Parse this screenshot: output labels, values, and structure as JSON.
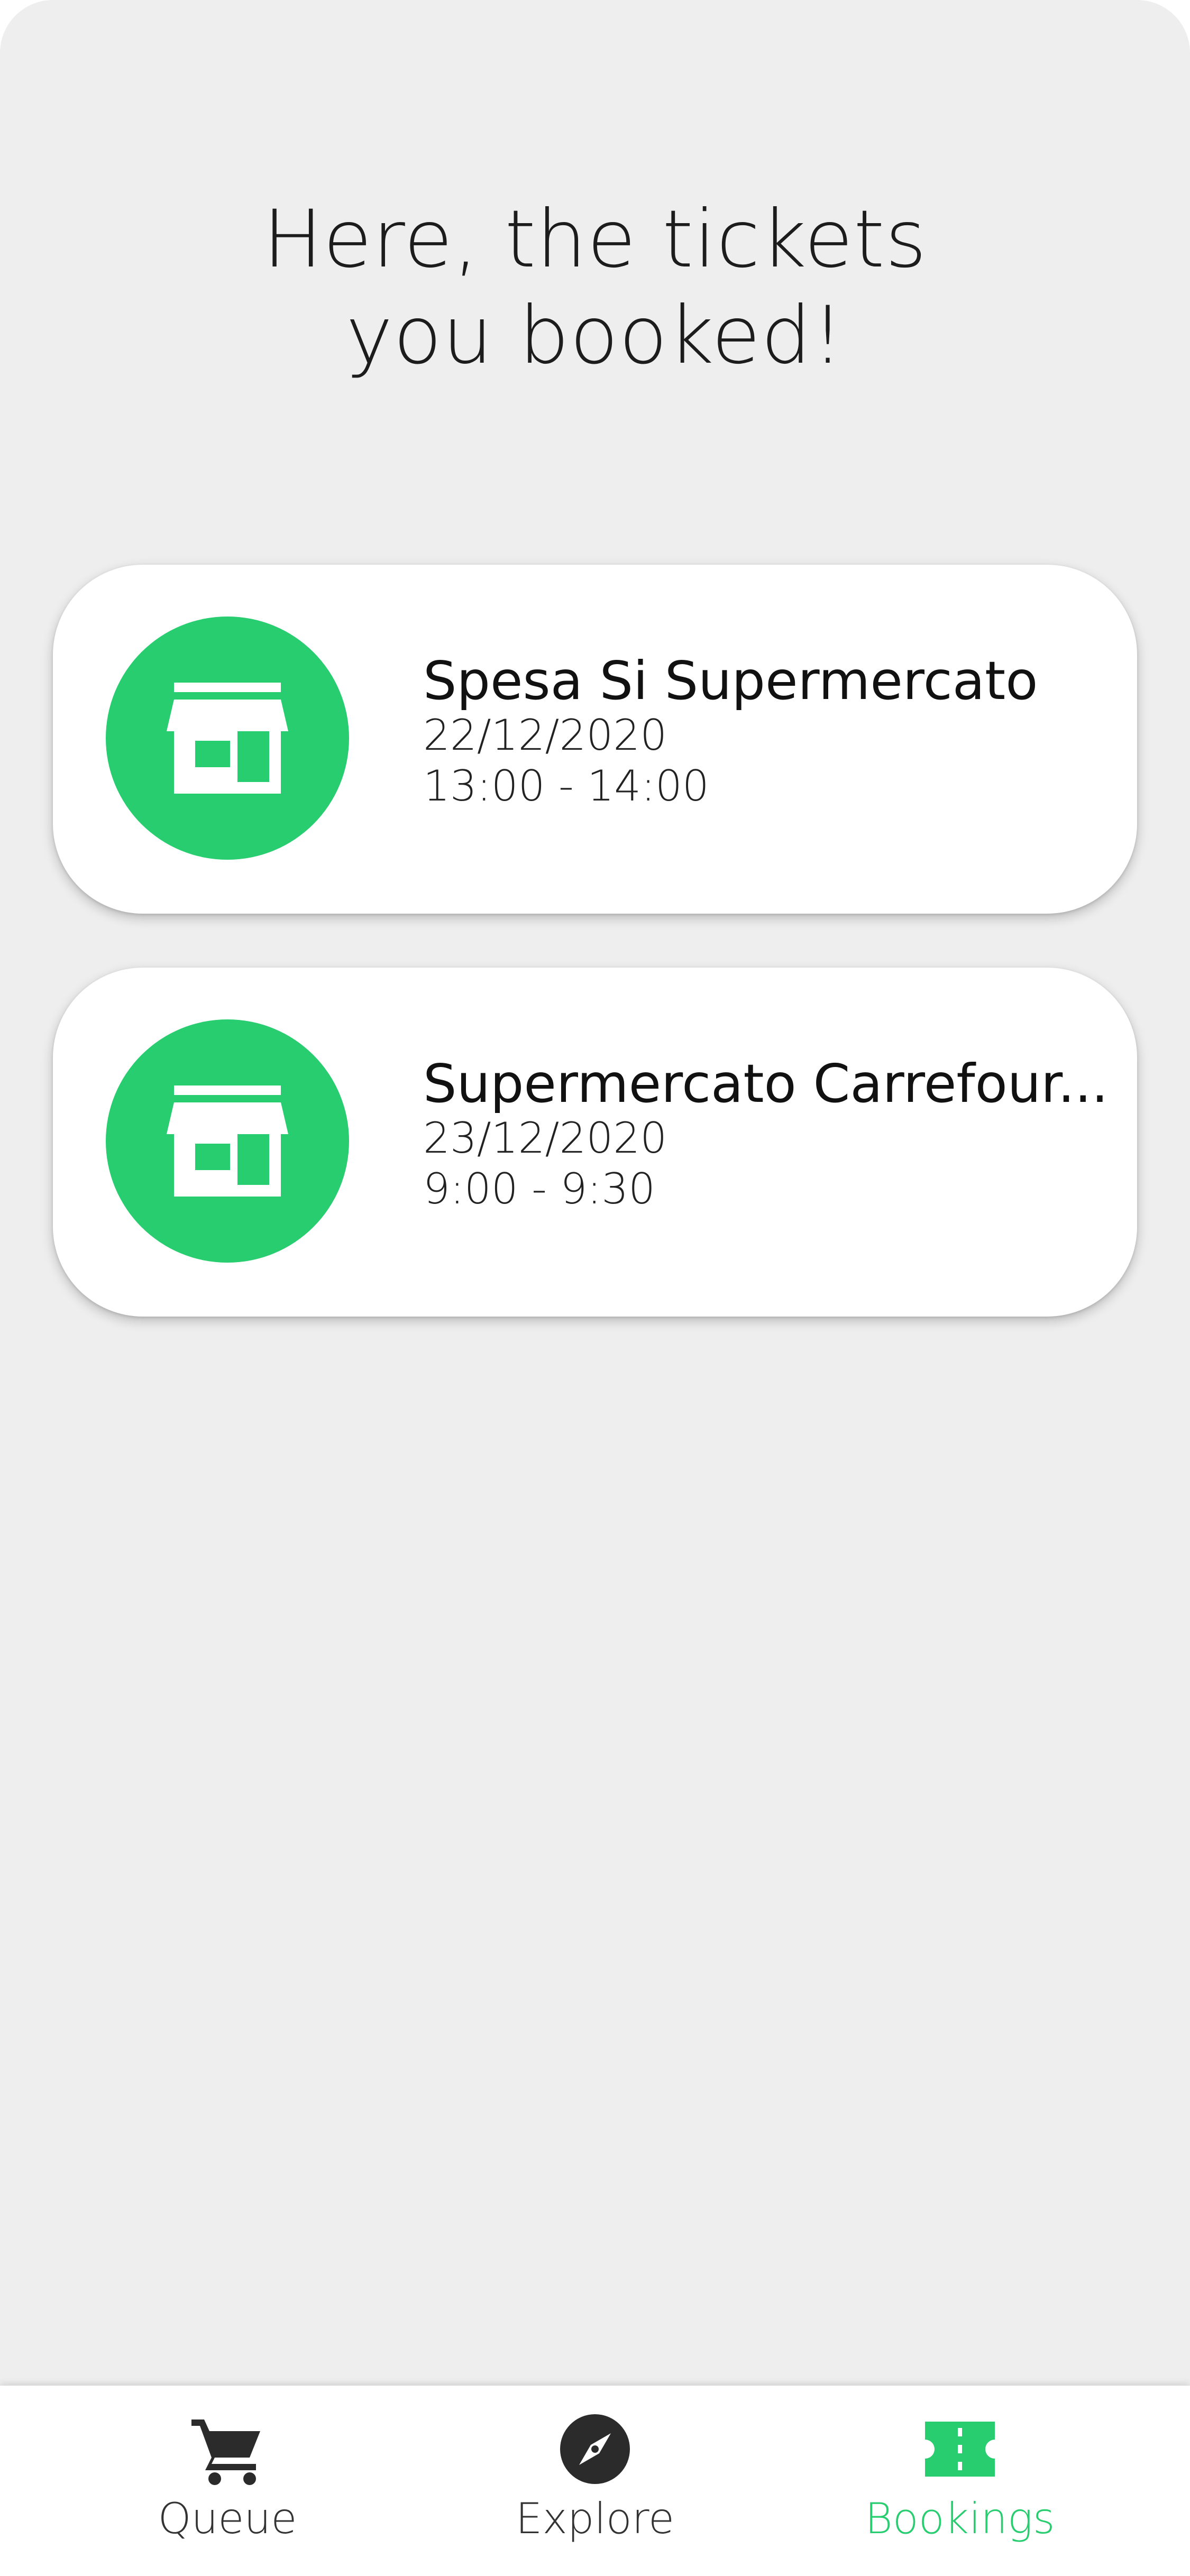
{
  "header": {
    "title_line1": "Here, the tickets",
    "title_line2": "you booked!"
  },
  "bookings": [
    {
      "store_name": "Spesa Si Supermercato",
      "date": "22/12/2020",
      "time": "13:00 - 14:00",
      "icon": "store-icon"
    },
    {
      "store_name": "Supermercato Carrefour...",
      "date": "23/12/2020",
      "time": "9:00 - 9:30",
      "icon": "store-icon"
    }
  ],
  "nav": {
    "items": [
      {
        "label": "Queue",
        "icon": "cart-icon",
        "active": false
      },
      {
        "label": "Explore",
        "icon": "compass-icon",
        "active": false
      },
      {
        "label": "Bookings",
        "icon": "ticket-icon",
        "active": true
      }
    ]
  },
  "colors": {
    "accent": "#27cd6f",
    "background": "#eeeeee",
    "card": "#ffffff",
    "icon_dark": "#2b2b2b"
  }
}
